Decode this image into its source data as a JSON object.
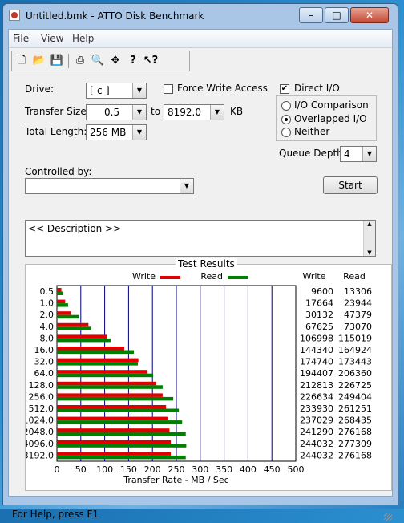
{
  "window": {
    "title": "Untitled.bmk - ATTO Disk Benchmark"
  },
  "window_controls": {
    "minimize": "–",
    "maximize": "□",
    "close": "✕"
  },
  "menu": [
    "File",
    "View",
    "Help"
  ],
  "toolbar": [
    "new-icon",
    "open-icon",
    "save-icon",
    "print-icon",
    "print-preview-icon",
    "move-icon",
    "help-icon",
    "context-help-icon"
  ],
  "form": {
    "drive_label": "Drive:",
    "drive_value": "[-c-]",
    "force_write_label": "Force Write Access",
    "direct_io_label": "Direct I/O",
    "direct_io_checked": true,
    "transfer_size_label": "Transfer Size:",
    "transfer_from": "0.5",
    "to_label": "to",
    "transfer_to": "8192.0",
    "kb_label": "KB",
    "total_length_label": "Total Length:",
    "total_length_value": "256 MB",
    "io_comparison_label": "I/O Comparison",
    "overlapped_io_label": "Overlapped I/O",
    "neither_label": "Neither",
    "selected_mode": "Overlapped I/O",
    "queue_depth_label": "Queue Depth:",
    "queue_depth_value": "4",
    "controlled_by_label": "Controlled by:",
    "controlled_by_value": "",
    "start_label": "Start",
    "description": "<< Description >>"
  },
  "results": {
    "title": "Test Results",
    "write_legend": "Write",
    "read_legend": "Read",
    "write_col": "Write",
    "read_col": "Read"
  },
  "status": {
    "text": "For Help, press F1"
  },
  "chart_data": {
    "type": "bar",
    "orientation": "horizontal",
    "categories": [
      "0.5",
      "1.0",
      "2.0",
      "4.0",
      "8.0",
      "16.0",
      "32.0",
      "64.0",
      "128.0",
      "256.0",
      "512.0",
      "1024.0",
      "2048.0",
      "4096.0",
      "8192.0"
    ],
    "series": [
      {
        "name": "Write",
        "color": "#e00000",
        "values": [
          9600,
          17664,
          30132,
          67625,
          106998,
          144340,
          174740,
          194407,
          212813,
          226634,
          233930,
          237029,
          241290,
          244032,
          244032
        ]
      },
      {
        "name": "Read",
        "color": "#008000",
        "values": [
          13306,
          23944,
          47379,
          73070,
          115019,
          164924,
          173443,
          206360,
          226725,
          249404,
          261251,
          268435,
          276168,
          277309,
          276168
        ]
      }
    ],
    "xlabel": "Transfer Rate - MB / Sec",
    "xticks": [
      "0",
      "50",
      "100",
      "150",
      "200",
      "250",
      "300",
      "350",
      "400",
      "450",
      "500"
    ],
    "xlim": [
      0,
      500
    ],
    "grid": true,
    "legend": "top"
  }
}
